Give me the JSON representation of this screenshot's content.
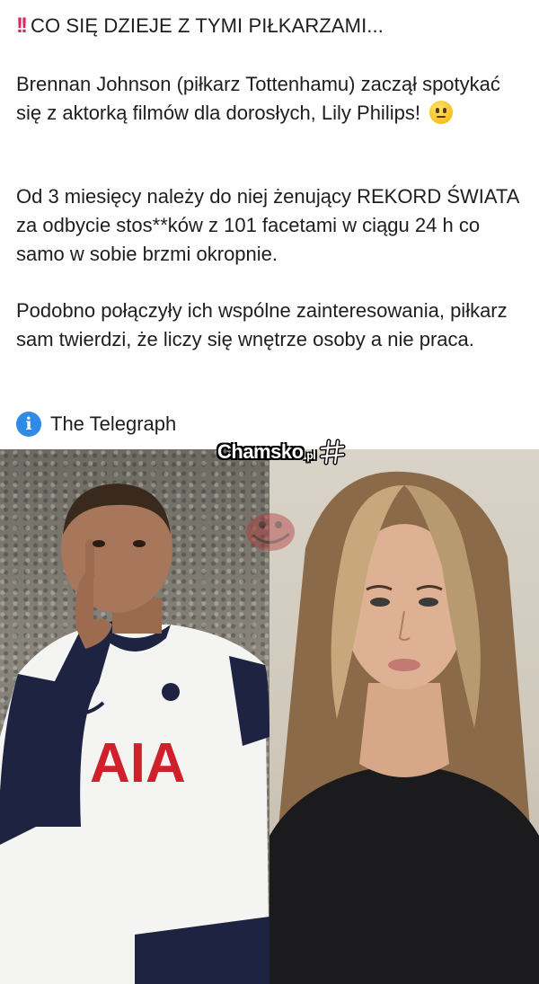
{
  "post": {
    "title": "CO SIĘ DZIEJE Z TYMI PIŁKARZAMI...",
    "title_icon": "double-exclamation-icon",
    "paragraphs": [
      "Brennan Johnson (piłkarz Tottenhamu) zaczął spotykać się z aktorką filmów dla dorosłych, Lily Philips!",
      "Od 3 miesięcy należy do niej żenujący REKORD ŚWIATA za odbycie stos**ków z 101 facetami w ciągu 24 h co samo w sobie brzmi okropnie.",
      "Podobno połączyły ich wspólne zainteresowania, piłkarz sam twierdzi, że liczy się wnętrze osoby a nie praca."
    ],
    "emoji": "neutral-face-emoji",
    "source_icon": "info-icon",
    "source": "The Telegraph"
  },
  "image": {
    "watermark_text": "Chamsko",
    "watermark_tld": ".pl",
    "shirt_text": "AIA",
    "left_photo": "footballer-photo",
    "right_photo": "woman-photo"
  },
  "colors": {
    "exclamation": "#e0245e",
    "info": "#2f8ae8",
    "text": "#1c1e21",
    "shirt_sponsor": "#d0202c"
  }
}
